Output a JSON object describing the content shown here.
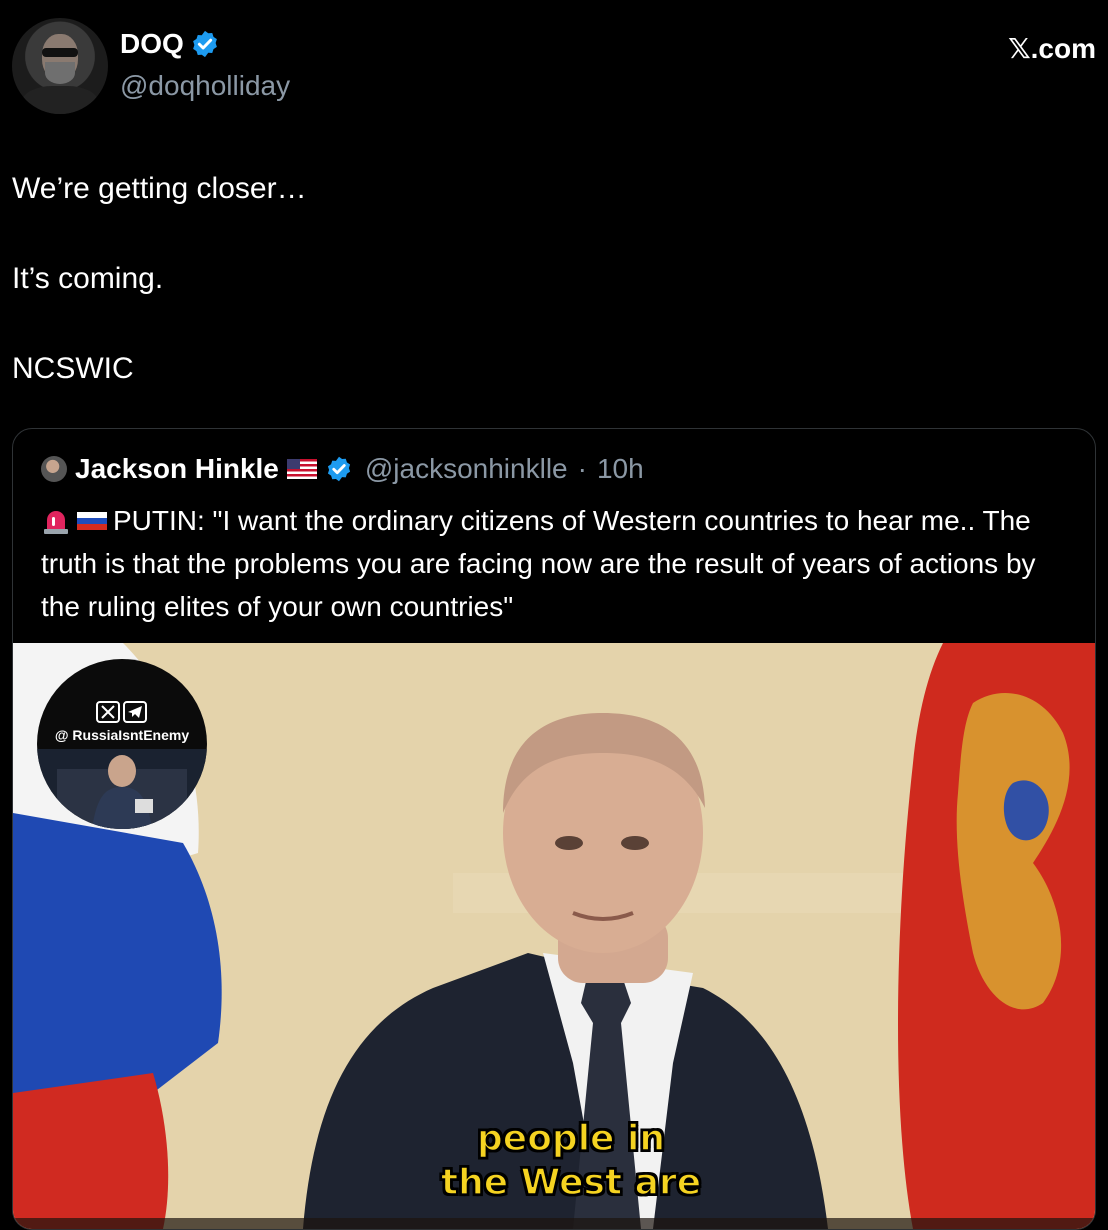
{
  "author": {
    "display_name": "DOQ",
    "handle": "@doqholliday",
    "avatar_icon": "profile-photo"
  },
  "brand": "𝕏.com",
  "tweet": {
    "lines": [
      "We’re getting closer…",
      "It’s coming.",
      "NCSWIC"
    ]
  },
  "quote": {
    "display_name": "Jackson Hinkle",
    "handle": "@jacksonhinklle",
    "separator": "·",
    "time": "10h",
    "flag_icon": "us-flag-icon",
    "text": "PUTIN: \"I want the ordinary citizens of Western countries to hear me.. The truth is that the problems you are facing now are the result of years of actions by the ruling elites of your own countries\"",
    "text_icons": [
      "siren-icon",
      "russia-flag-icon"
    ],
    "video": {
      "watermark": "@ RussiaIsntEnemy",
      "caption_line1": "people in",
      "caption_line2": "the West are"
    }
  },
  "colors": {
    "verified": "#1d9bf0",
    "handle_gray": "#8b98a5",
    "caption_yellow": "#f5d321"
  }
}
